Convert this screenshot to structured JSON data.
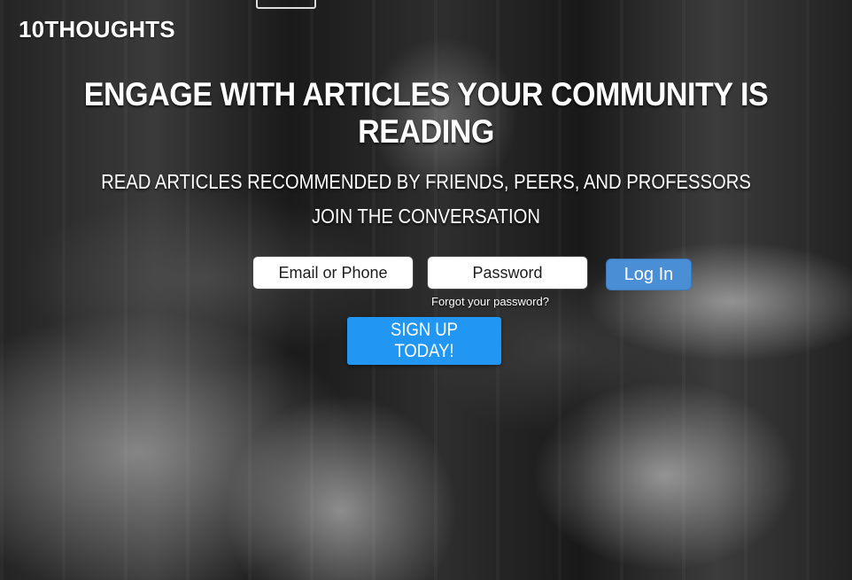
{
  "header": {
    "logo_text": "10THOUGHTS"
  },
  "hero": {
    "headline": "ENGAGE WITH ARTICLES YOUR COMMUNITY IS READING",
    "subline_1": "READ ARTICLES RECOMMENDED BY FRIENDS, PEERS, AND PROFESSORS",
    "subline_2": "JOIN THE CONVERSATION"
  },
  "login_form": {
    "email_placeholder": "Email or Phone",
    "password_placeholder": "Password",
    "login_label": "Log In",
    "forgot_password_label": "Forgot your password?"
  },
  "signup": {
    "button_label": "SIGN UP TODAY!"
  },
  "colors": {
    "login_button": "#4a8fd6",
    "signup_button": "#2196f3"
  }
}
